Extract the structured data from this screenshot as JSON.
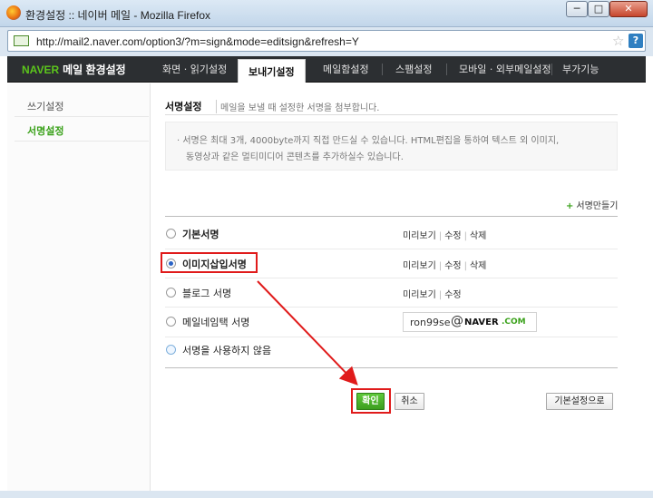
{
  "window": {
    "title": "환경설정 :: 네이버 메일 - Mozilla Firefox",
    "min_label": "─",
    "max_label": "□",
    "close_label": "✕"
  },
  "urlbar": {
    "url": "http://mail2.naver.com/option3/?m=sign&mode=editsign&refresh=Y",
    "star": "☆",
    "help": "?"
  },
  "nav": {
    "brand_naver": "NAVER",
    "brand_title": "메일 환경설정",
    "tabs": [
      {
        "label": "화면 · 읽기설정"
      },
      {
        "label": "보내기설정",
        "active": true
      },
      {
        "label": "메일함설정"
      },
      {
        "label": "스팸설정"
      },
      {
        "label": "모바일 · 외부메일설정"
      },
      {
        "label": "부가기능"
      }
    ]
  },
  "sidebar": {
    "items": [
      {
        "label": "쓰기설정",
        "active": false
      },
      {
        "label": "서명설정",
        "active": true
      }
    ]
  },
  "section": {
    "title": "서명설정",
    "desc": "메일을 보낼 때 설정한 서명을 첨부합니다.",
    "notes": [
      "· 서명은 최대 3개, 4000byte까지 직접 만드실 수 있습니다. HTML편집을 통하여 텍스트 외 이미지,",
      "동영상과 같은 멀티미디어 콘텐츠를 추가하실수 있습니다."
    ],
    "make_signature": "서명만들기"
  },
  "options": [
    {
      "label": "기본서명",
      "checked": false,
      "actions": [
        "미리보기",
        "수정",
        "삭제"
      ]
    },
    {
      "label": "이미지삽입서명",
      "checked": true,
      "actions": [
        "미리보기",
        "수정",
        "삭제"
      ]
    },
    {
      "label": "블로그 서명",
      "checked": false,
      "actions": [
        "미리보기",
        "수정"
      ]
    },
    {
      "label": "메일네임택 서명",
      "checked": false,
      "email_id": "ron99se",
      "email_at": "@",
      "email_domain": "NAVER",
      "email_tld": ".COM"
    },
    {
      "label": "서명을 사용하지 않음",
      "checked": false
    }
  ],
  "buttons": {
    "ok": "확인",
    "cancel": "취소",
    "default": "기본설정으로"
  },
  "colors": {
    "accent_green": "#3aa11a",
    "nav_dark": "#2c2f32",
    "annotation_red": "#e01b1b",
    "radio_blue": "#2862c5"
  }
}
